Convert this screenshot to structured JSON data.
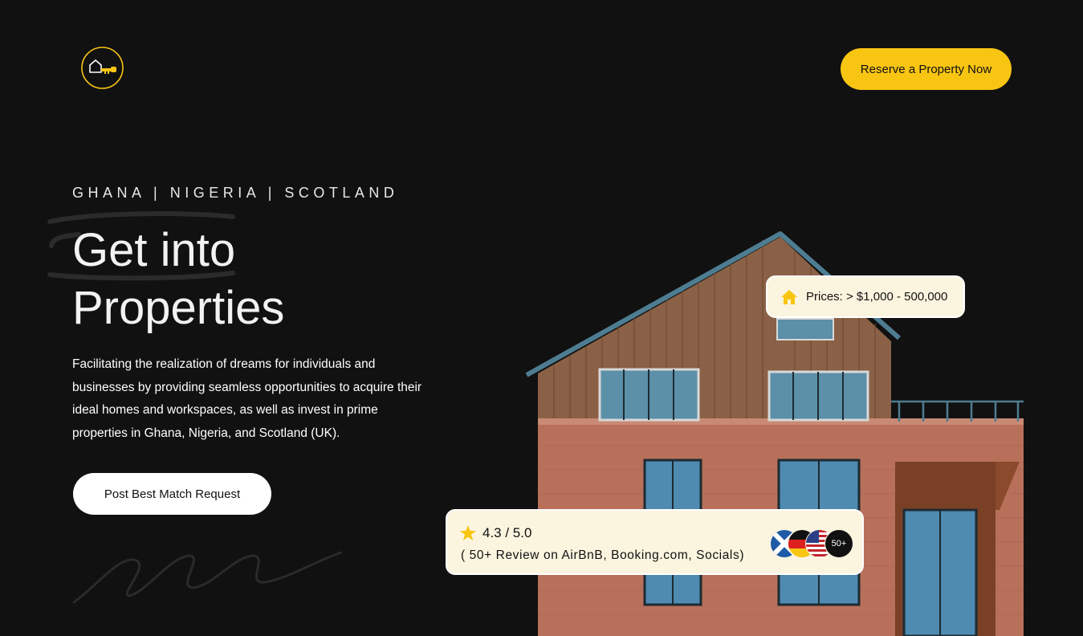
{
  "header": {
    "logo_icon": "house-key-icon",
    "cta_label": "Reserve a Property Now"
  },
  "hero": {
    "countries": "GHANA | NIGERIA | SCOTLAND",
    "headline_line1": "Get into",
    "headline_line2": "Properties",
    "description": "Facilitating the realization of dreams for individuals and businesses by providing seamless opportunities to acquire their ideal homes and workspaces, as well as invest in prime properties in Ghana, Nigeria, and Scotland (UK).",
    "button_label": "Post Best Match Request"
  },
  "price_card": {
    "icon": "home-icon",
    "text": "Prices: > $1,000 - 500,000"
  },
  "review_card": {
    "icon": "star-icon",
    "rating": "4.3 / 5.0",
    "reviews_text": "( 50+ Review on AirBnB, Booking.com, Socials)",
    "flags": [
      "scotland-flag-icon",
      "germany-flag-icon",
      "usa-flag-icon"
    ],
    "more_label": "50+"
  },
  "colors": {
    "background": "#111111",
    "accent": "#f8c513",
    "card": "#fbf4df"
  }
}
